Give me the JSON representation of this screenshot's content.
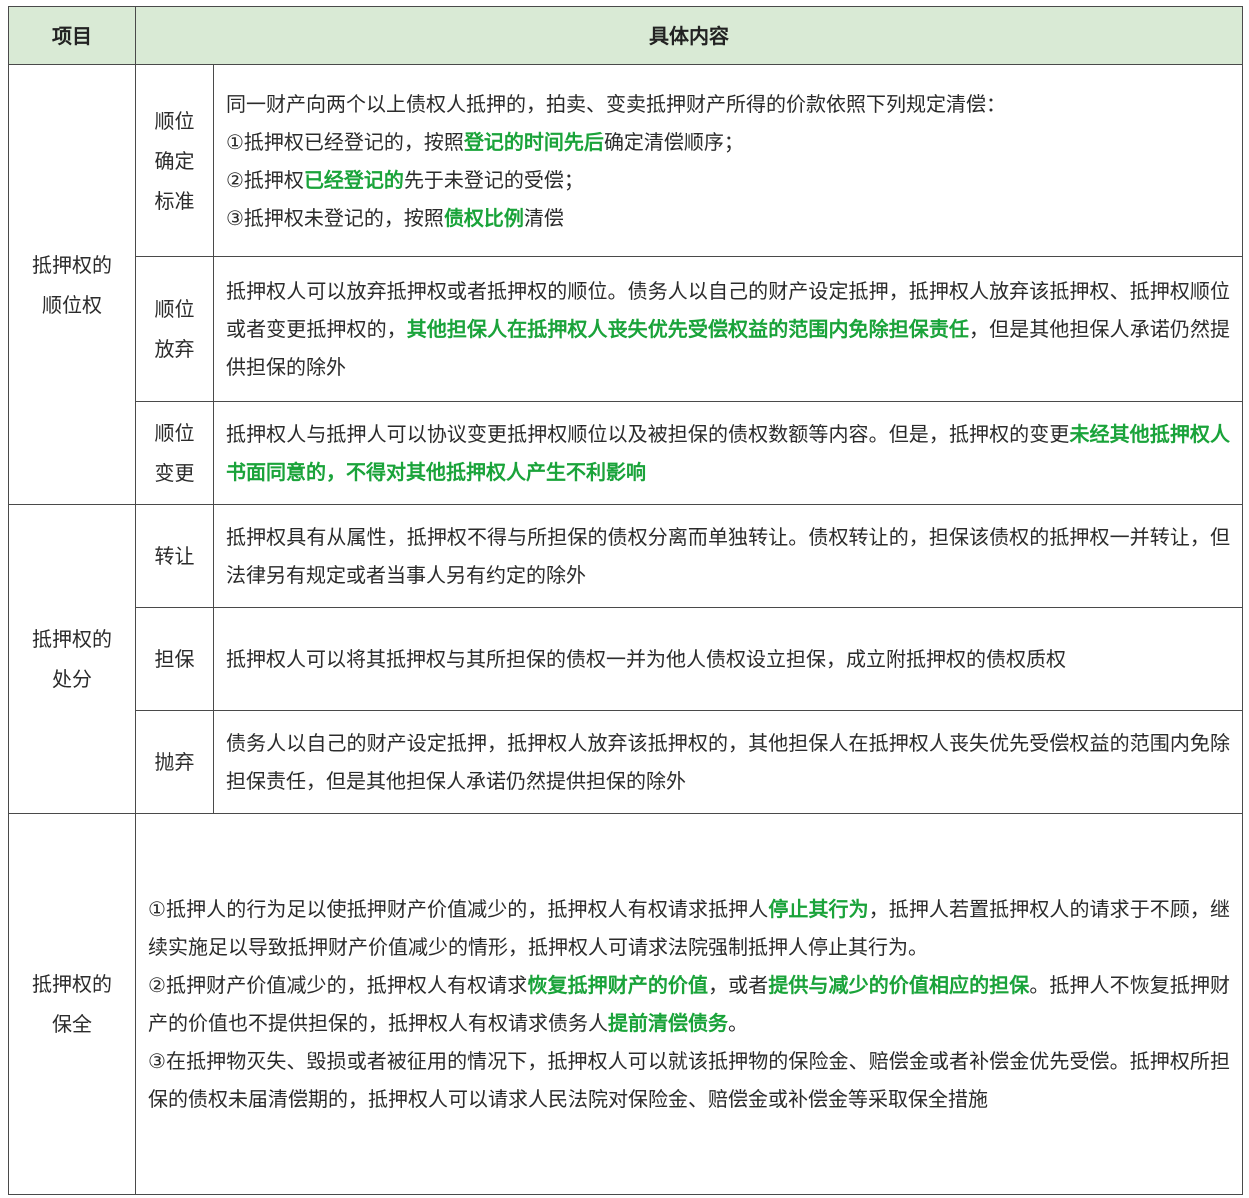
{
  "header": {
    "col1": "项目",
    "col2": "具体内容"
  },
  "rows": {
    "order": {
      "label": "抵押权的顺位权",
      "label_line1": "抵押权的",
      "label_line2": "顺位权",
      "standard": {
        "label_line1": "顺位",
        "label_line2": "确定",
        "label_line3": "标准",
        "p0": "同一财产向两个以上债权人抵押的，拍卖、变卖抵押财产所得的价款依照下列规定清偿：",
        "p1_a": "①抵押权已经登记的，按照",
        "p1_b": "登记的时间先后",
        "p1_c": "确定清偿顺序；",
        "p2_a": "②抵押权",
        "p2_b": "已经登记的",
        "p2_c": "先于未登记的受偿；",
        "p3_a": "③抵押权未登记的，按照",
        "p3_b": "债权比例",
        "p3_c": "清偿"
      },
      "waive": {
        "label_line1": "顺位",
        "label_line2": "放弃",
        "t_a": "抵押权人可以放弃抵押权或者抵押权的顺位。债务人以自己的财产设定抵押，抵押权人放弃该抵押权、抵押权顺位或者变更抵押权的，",
        "t_b": "其他担保人在抵押权人丧失优先受偿权益的范围内免除担保责任",
        "t_c": "，但是其他担保人承诺仍然提供担保的除外"
      },
      "change": {
        "label_line1": "顺位",
        "label_line2": "变更",
        "t_a": "抵押权人与抵押人可以协议变更抵押权顺位以及被担保的债权数额等内容。但是，抵押权的变更",
        "t_b": "未经其他抵押权人书面同意的，不得对其他抵押权人产生不利影响"
      }
    },
    "disposal": {
      "label_line1": "抵押权的",
      "label_line2": "处分",
      "transfer": {
        "label": "转让",
        "text": "抵押权具有从属性，抵押权不得与所担保的债权分离而单独转让。债权转让的，担保该债权的抵押权一并转让，但法律另有规定或者当事人另有约定的除外"
      },
      "guarantee": {
        "label": "担保",
        "text": "抵押权人可以将其抵押权与其所担保的债权一并为他人债权设立担保，成立附抵押权的债权质权"
      },
      "abandon": {
        "label": "抛弃",
        "text": "债务人以自己的财产设定抵押，抵押权人放弃该抵押权的，其他担保人在抵押权人丧失优先受偿权益的范围内免除担保责任，但是其他担保人承诺仍然提供担保的除外"
      }
    },
    "preservation": {
      "label_line1": "抵押权的",
      "label_line2": "保全",
      "p1_a": "①抵押人的行为足以使抵押财产价值减少的，抵押权人有权请求抵押人",
      "p1_b": "停止其行为",
      "p1_c": "，抵押人若置抵押权人的请求于不顾，继续实施足以导致抵押财产价值减少的情形，抵押权人可请求法院强制抵押人停止其行为。",
      "p2_a": "②抵押财产价值减少的，抵押权人有权请求",
      "p2_b": "恢复抵押财产的价值",
      "p2_c": "，或者",
      "p2_d": "提供与减少的价值相应的担保",
      "p2_e": "。抵押人不恢复抵押财产的价值也不提供担保的，抵押权人有权请求债务人",
      "p2_f": "提前清偿债务",
      "p2_g": "。",
      "p3": "③在抵押物灭失、毁损或者被征用的情况下，抵押权人可以就该抵押物的保险金、赔偿金或者补偿金优先受偿。抵押权所担保的债权未届清偿期的，抵押权人可以请求人民法院对保险金、赔偿金或补偿金等采取保全措施"
    }
  },
  "colors": {
    "header_bg": "#d9ead5",
    "highlight": "#1aa33a",
    "border": "#4a4a4a"
  }
}
